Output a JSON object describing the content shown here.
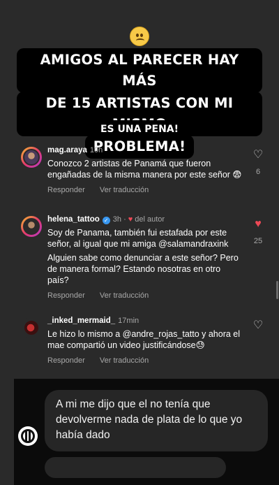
{
  "top_emoji": "upside-down-face-icon",
  "headline": [
    "AMIGOS AL PARECER HAY MÁS",
    "DE 15 ARTISTAS CON MI MISMO",
    "PROBLEMA!"
  ],
  "subhead": "ES UNA PENA!",
  "comments": [
    {
      "user": "mag.araya",
      "time": "10h",
      "text": [
        "Conozco 2 artistas de Panamá que fueron engañadas de la misma manera por este señor 😨"
      ],
      "reply": "Responder",
      "translate": "Ver traducción",
      "likes": "6",
      "liked": false
    },
    {
      "user": "helena_tattoo",
      "time": "3h",
      "by_author": "del autor",
      "text": [
        "Soy de Panama, también fui estafada por este señor, al igual que mi amiga @salamandraxink",
        "Alguien sabe como denunciar a este señor? Pero de manera formal? Estando nosotras en otro país?"
      ],
      "reply": "Responder",
      "translate": "Ver traducción",
      "likes": "25",
      "liked": true
    },
    {
      "user": "_inked_mermaid_",
      "time": "17min",
      "text": [
        "Le hizo lo mismo a @andre_rojas_tatto  y ahora el mae compartió un video justificándose😓"
      ],
      "reply": "Responder",
      "translate": "Ver traducción",
      "liked": false
    }
  ],
  "message_bubble": "A mi me dijo que el no tenía que devolverme nada de plata de lo que yo había dado"
}
